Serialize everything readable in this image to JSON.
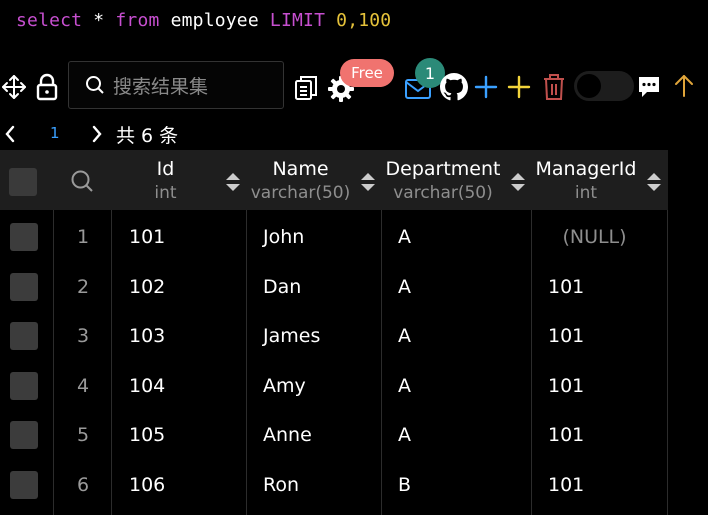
{
  "query": {
    "select_kw": "select",
    "star": "*",
    "from_kw": "from",
    "table": "employee",
    "limit_kw": "LIMIT",
    "limit_val": "0,100"
  },
  "toolbar": {
    "search_placeholder": "搜索结果集",
    "free_badge": "Free",
    "count_badge": "1",
    "icons": [
      "move-icon",
      "lock-icon",
      "search-icon",
      "copy-icon",
      "gear-icon",
      "mail-icon",
      "github-icon",
      "plus-icon",
      "plus-icon",
      "trash-icon",
      "toggle",
      "comment-icon",
      "arrow-up-icon"
    ],
    "colors": {
      "blue_plus": "#3aa0ff",
      "yellow_plus": "#f2d43b",
      "trash": "#c0504d",
      "arrow": "#e0a53a",
      "mail": "#3aa0ff"
    }
  },
  "pager": {
    "page": "1",
    "total": "共 6 条"
  },
  "table": {
    "columns": [
      {
        "name": "Id",
        "type": "int"
      },
      {
        "name": "Name",
        "type": "varchar(50)"
      },
      {
        "name": "Department",
        "type": "varchar(50)"
      },
      {
        "name": "ManagerId",
        "type": "int"
      }
    ],
    "rows": [
      {
        "num": "1",
        "Id": "101",
        "Name": "John",
        "Department": "A",
        "ManagerId": "(NULL)"
      },
      {
        "num": "2",
        "Id": "102",
        "Name": "Dan",
        "Department": "A",
        "ManagerId": "101"
      },
      {
        "num": "3",
        "Id": "103",
        "Name": "James",
        "Department": "A",
        "ManagerId": "101"
      },
      {
        "num": "4",
        "Id": "104",
        "Name": "Amy",
        "Department": "A",
        "ManagerId": "101"
      },
      {
        "num": "5",
        "Id": "105",
        "Name": "Anne",
        "Department": "A",
        "ManagerId": "101"
      },
      {
        "num": "6",
        "Id": "106",
        "Name": "Ron",
        "Department": "B",
        "ManagerId": "101"
      }
    ]
  }
}
